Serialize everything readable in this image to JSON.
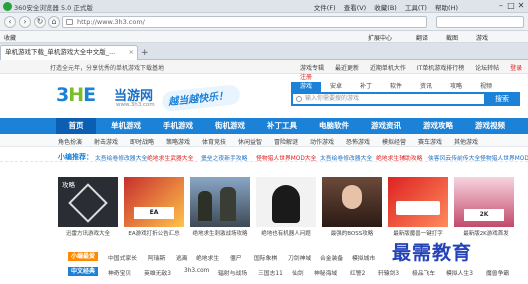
{
  "browser": {
    "window_title": "360安全浏览器 5.0 正式版",
    "menus": [
      "文件(F)",
      "查看(V)",
      "收藏(B)",
      "工具(T)",
      "帮助(H)"
    ],
    "url": "http://www.3h3.com/",
    "bookmarks": [
      "收藏",
      "扩展中心",
      "翻译",
      "截图",
      "游戏"
    ],
    "tab_title": "单机游戏下载_单机游戏大全中文版_..."
  },
  "site": {
    "welcome": "打造全元年，分享优秀的单机游戏下载基地",
    "top_links": [
      "游戏专辑",
      "最近更新",
      "近期单机大作",
      "IT单机游戏排行榜",
      "论坛转帖",
      "登录注册"
    ],
    "logo_letters": "3HE",
    "logo_name": "当游网",
    "logo_url": "www.3h3.com",
    "slogan": "越当越快乐！",
    "search_tabs": [
      "游戏",
      "安卓",
      "补丁",
      "软件",
      "资讯",
      "攻略",
      "视频"
    ],
    "search_placeholder": "输入你需要搜的游戏",
    "search_button": "搜索",
    "main_nav": [
      "首页",
      "单机游戏",
      "手机游戏",
      "街机游戏",
      "补丁工具",
      "电脑软件",
      "游戏资讯",
      "游戏攻略",
      "游戏视频"
    ],
    "sub_nav": [
      "角色扮演",
      "射击游戏",
      "即时战略",
      "策略游戏",
      "体育竞技",
      "休闲益智",
      "冒险解谜",
      "动作游戏",
      "恐怖游戏",
      "模拟经营",
      "赛车游戏",
      "其他游戏"
    ],
    "xiaobian": {
      "label": "小编推荐：",
      "items": [
        {
          "text": "太吾绘卷修改器大全",
          "color": "blue"
        },
        {
          "text": "绝地求生武器大全",
          "color": "red"
        },
        {
          "text": "堡垒之夜新手攻略",
          "color": "blue"
        },
        {
          "text": "怪物猎人世界MOD大全",
          "color": "red"
        },
        {
          "text": "太吾绘卷修改器大全",
          "color": "blue"
        },
        {
          "text": "绝地求生辅助攻略",
          "color": "red"
        },
        {
          "text": "侠客风云传前传大全",
          "color": "blue"
        },
        {
          "text": "怪物猎人世界MOD大全",
          "color": "blue"
        }
      ]
    },
    "gallery": {
      "label": "攻略",
      "captions": [
        "迅雷方讯游戏大全",
        "EA游戏打折公告汇总",
        "绝地求生刺激战场攻略",
        "绝地也有机器人问题",
        "最强的BOSS攻略",
        "最新版魔兽一键打字",
        "怪物猎人世界攻略汇总",
        "最新版2K游戏首发"
      ]
    },
    "row1": {
      "badge": "小编最爱",
      "items": [
        "中国式家长",
        "阿瑞斯",
        "逃离",
        "绝地求生",
        "僵尸",
        "国际象棋",
        "刀剑神域",
        "合金装备",
        "模拟城市",
        "古墓",
        "罪恶都市"
      ]
    },
    "row2": {
      "badge": "中文经典",
      "items": [
        "神奇宝贝",
        "英雄无敌3",
        "3h3.com",
        "辐射与战场",
        "三国志11",
        "仙剑",
        "神秘海域",
        "红警2",
        "轩辕剑3",
        "极品飞车",
        "模拟人生3",
        "魔兽争霸"
      ]
    },
    "watermark": "最需教育"
  },
  "colors": {
    "brand_blue": "#1b82d8",
    "nav_active": "#0a5fb3",
    "accent_red": "#e02020",
    "logo_green": "#7dbd2c"
  }
}
